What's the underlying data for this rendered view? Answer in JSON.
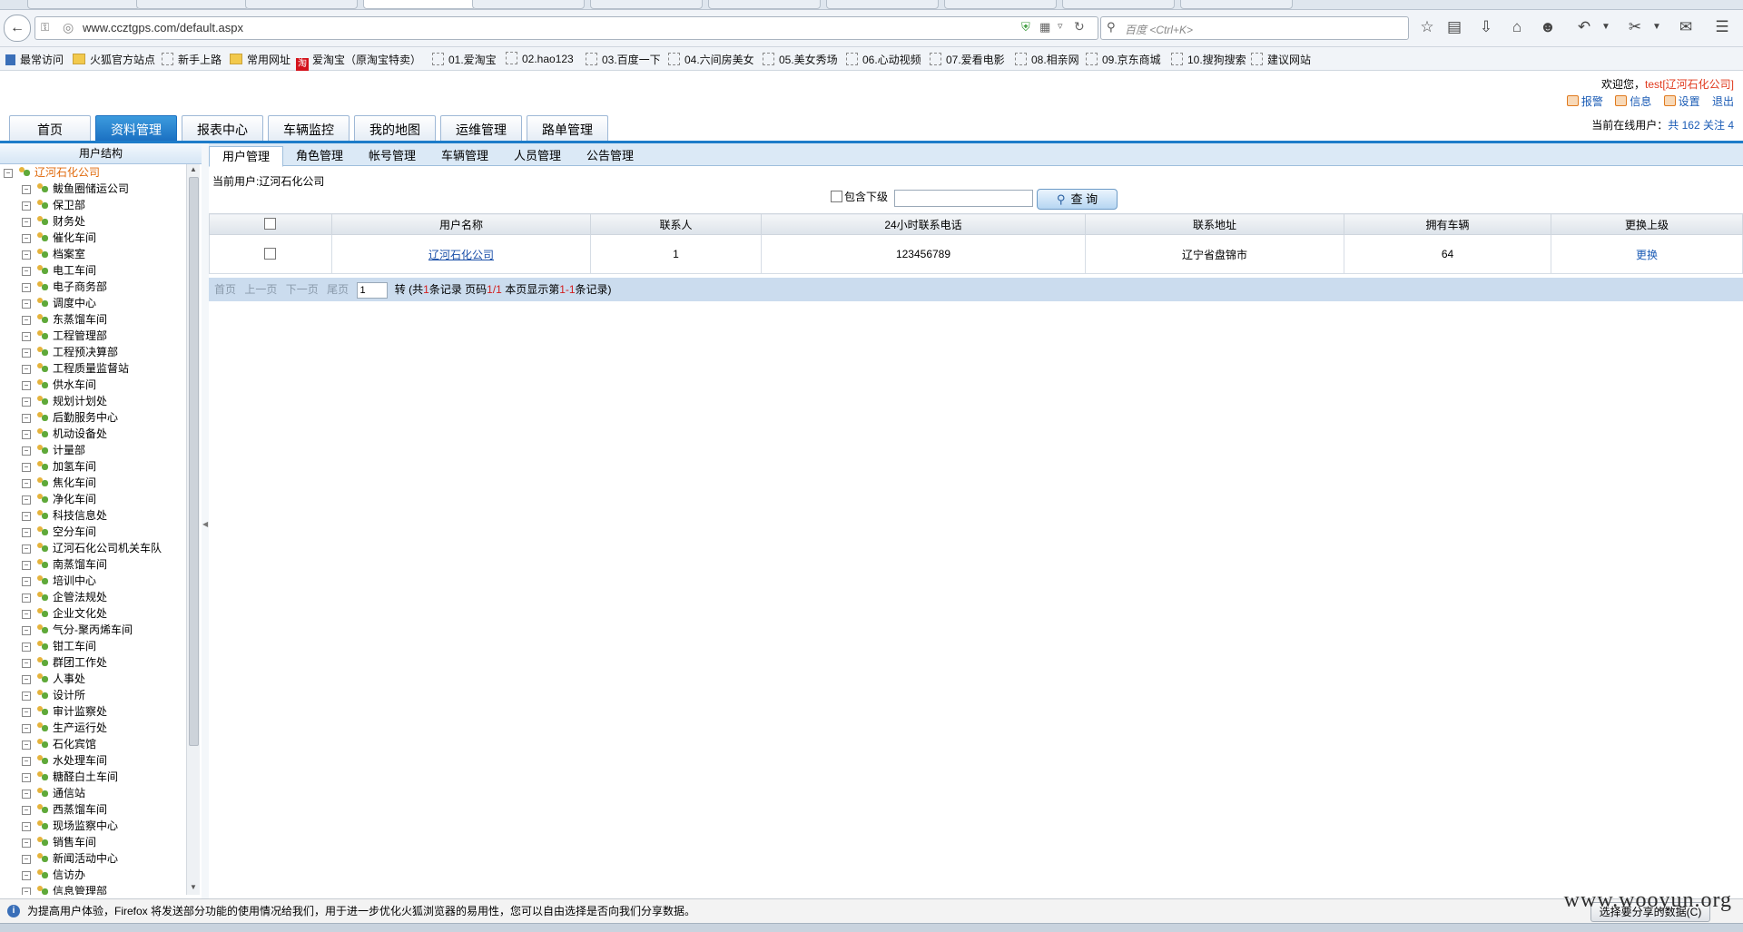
{
  "browser": {
    "tabs": [
      "",
      "",
      "",
      "",
      "",
      "",
      "",
      "",
      "",
      "",
      ""
    ],
    "url": "www.ccztgps.com/default.aspx",
    "search_placeholder": "百度 <Ctrl+K>",
    "bookmarks": [
      "最常访问",
      "火狐官方站点",
      "新手上路",
      "常用网址",
      "爱淘宝（原淘宝特卖）",
      "01.爱淘宝",
      "02.hao123",
      "03.百度一下",
      "04.六间房美女",
      "05.美女秀场",
      "06.心动视频",
      "07.爱看电影",
      "08.相亲网",
      "09.京东商城",
      "10.搜狗搜索",
      "建议网站"
    ]
  },
  "header": {
    "welcome_prefix": "欢迎您，",
    "welcome_user": "test[辽河石化公司]",
    "links": [
      "报警",
      "信息",
      "设置",
      "退出"
    ],
    "online_label": "当前在线用户：",
    "online_value": "共 162 关注 4"
  },
  "main_tabs": [
    "首页",
    "资料管理",
    "报表中心",
    "车辆监控",
    "我的地图",
    "运维管理",
    "路单管理"
  ],
  "left_panel": {
    "title": "用户结构",
    "root": "辽河石化公司",
    "nodes": [
      "鲅鱼圈储运公司",
      "保卫部",
      "财务处",
      "催化车间",
      "档案室",
      "电工车间",
      "电子商务部",
      "调度中心",
      "东蒸馏车间",
      "工程管理部",
      "工程预决算部",
      "工程质量监督站",
      "供水车间",
      "规划计划处",
      "后勤服务中心",
      "机动设备处",
      "计量部",
      "加氢车间",
      "焦化车间",
      "净化车间",
      "科技信息处",
      "空分车间",
      "辽河石化公司机关车队",
      "南蒸馏车间",
      "培训中心",
      "企管法规处",
      "企业文化处",
      "气分-聚丙烯车间",
      "钳工车间",
      "群团工作处",
      "人事处",
      "设计所",
      "审计监察处",
      "生产运行处",
      "石化宾馆",
      "水处理车间",
      "糖醛白土车间",
      "通信站",
      "西蒸馏车间",
      "现场监察中心",
      "销售车间",
      "新闻活动中心",
      "信访办",
      "信息管理部"
    ]
  },
  "sub_tabs": [
    "用户管理",
    "角色管理",
    "帐号管理",
    "车辆管理",
    "人员管理",
    "公告管理"
  ],
  "current_user_label": "当前用户:辽河石化公司",
  "filter": {
    "include_label": "包含下级",
    "query_button": "查 询"
  },
  "table": {
    "headers": [
      "",
      "用户名称",
      "联系人",
      "24小时联系电话",
      "联系地址",
      "拥有车辆",
      "更换上级"
    ],
    "rows": [
      {
        "name": "辽河石化公司",
        "contact": "1",
        "phone": "123456789",
        "address": "辽宁省盘锦市",
        "vehicles": "64",
        "action": "更换"
      }
    ]
  },
  "pager": {
    "first": "首页",
    "prev": "上一页",
    "next": "下一页",
    "last": "尾页",
    "page_value": "1",
    "go": "转",
    "t1": "(共",
    "total": "1",
    "t2": "条记录 页码",
    "page": "1/1",
    "t3": " 本页显示第",
    "range": "1-1",
    "t4": "条记录)"
  },
  "notification": {
    "text": "为提高用户体验，Firefox 将发送部分功能的使用情况给我们，用于进一步优化火狐浏览器的易用性，您可以自由选择是否向我们分享数据。",
    "button": "选择要分享的数据(C)"
  },
  "watermark": "www.wooyun.org",
  "colors": {
    "accent": "#1d7cc9",
    "active_tab": "#1a6fc1",
    "link": "#1a5bb5",
    "highlight": "#e03a1e"
  }
}
